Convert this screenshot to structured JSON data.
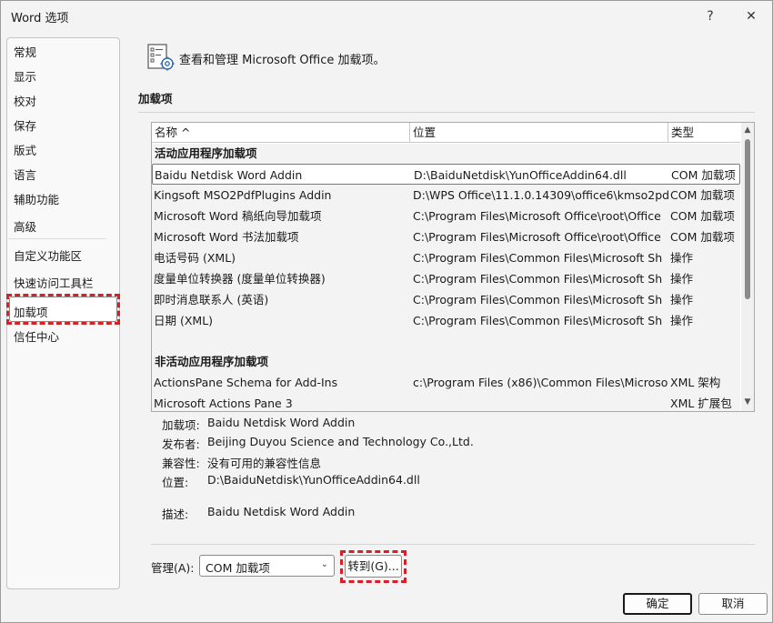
{
  "window": {
    "title": "Word 选项",
    "help_icon": "?",
    "close_icon": "✕"
  },
  "sidebar": {
    "items": [
      {
        "label": "常规"
      },
      {
        "label": "显示"
      },
      {
        "label": "校对"
      },
      {
        "label": "保存"
      },
      {
        "label": "版式"
      },
      {
        "label": "语言"
      },
      {
        "label": "辅助功能"
      },
      {
        "label": "高级"
      },
      {
        "label": "自定义功能区"
      },
      {
        "label": "快速访问工具栏"
      },
      {
        "label": "加载项"
      },
      {
        "label": "信任中心"
      }
    ],
    "selected": "加载项"
  },
  "header": {
    "text": "查看和管理 Microsoft Office 加载项。",
    "icon": "addins-gear-icon"
  },
  "section": {
    "label": "加载项"
  },
  "list": {
    "columns": {
      "name": "名称 ^",
      "location": "位置",
      "type": "类型"
    },
    "active_group": "活动应用程序加载项",
    "active_rows": [
      {
        "name": "Baidu Netdisk Word Addin",
        "location": "D:\\BaiduNetdisk\\YunOfficeAddin64.dll",
        "type": "COM 加载项"
      },
      {
        "name": "Kingsoft MSO2PdfPlugins Addin",
        "location": "D:\\WPS Office\\11.1.0.14309\\office6\\kmso2pdf",
        "type": "COM 加载项"
      },
      {
        "name": "Microsoft Word 稿纸向导加载项",
        "location": "C:\\Program Files\\Microsoft Office\\root\\Office",
        "type": "COM 加载项"
      },
      {
        "name": "Microsoft Word 书法加载项",
        "location": "C:\\Program Files\\Microsoft Office\\root\\Office",
        "type": "COM 加载项"
      },
      {
        "name": "电话号码 (XML)",
        "location": "C:\\Program Files\\Common Files\\Microsoft Sh",
        "type": "操作"
      },
      {
        "name": "度量单位转换器 (度量单位转换器)",
        "location": "C:\\Program Files\\Common Files\\Microsoft Sh",
        "type": "操作"
      },
      {
        "name": "即时消息联系人 (英语)",
        "location": "C:\\Program Files\\Common Files\\Microsoft Sh",
        "type": "操作"
      },
      {
        "name": "日期 (XML)",
        "location": "C:\\Program Files\\Common Files\\Microsoft Sh",
        "type": "操作"
      }
    ],
    "inactive_group": "非活动应用程序加载项",
    "inactive_rows": [
      {
        "name": "ActionsPane Schema for Add-Ins",
        "location": "c:\\Program Files (x86)\\Common Files\\Microso",
        "type": "XML 架构"
      },
      {
        "name": "Microsoft Actions Pane 3",
        "location": "",
        "type": "XML 扩展包"
      }
    ],
    "scroll_up_icon": "▲",
    "scroll_down_icon": "▼"
  },
  "details": {
    "addin_label": "加载项:",
    "addin_value": "Baidu Netdisk Word Addin",
    "publisher_label": "发布者:",
    "publisher_value": "Beijing Duyou Science and Technology Co.,Ltd.",
    "compat_label": "兼容性:",
    "compat_value": "没有可用的兼容性信息",
    "location_label": "位置:",
    "location_value": "D:\\BaiduNetdisk\\YunOfficeAddin64.dll",
    "desc_label": "描述:",
    "desc_value": "Baidu Netdisk Word Addin"
  },
  "manage": {
    "label": "管理(A):",
    "selected_option": "COM 加载项",
    "go_label": "转到(G)..."
  },
  "buttons": {
    "ok": "确定",
    "cancel": "取消"
  },
  "colors": {
    "highlight_dash": "#d61f26"
  }
}
